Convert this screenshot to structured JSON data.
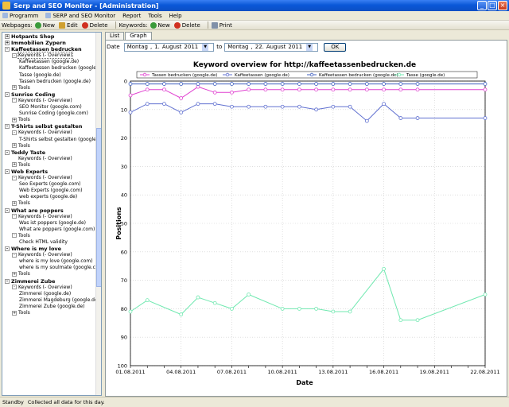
{
  "window": {
    "title": "Serp and SEO Monitor - [Administration]"
  },
  "menu": [
    {
      "label": "Programm"
    },
    {
      "label": "SERP and SEO Monitor"
    },
    {
      "label": "Report"
    },
    {
      "label": "Tools"
    },
    {
      "label": "Help"
    }
  ],
  "toolbar": {
    "webpages_label": "Webpages:",
    "new1": "New",
    "edit": "Edit",
    "delete1": "Delete",
    "keywords_label": "Keywords:",
    "new2": "New",
    "delete2": "Delete",
    "print": "Print"
  },
  "tree": [
    {
      "level": 0,
      "bold": true,
      "pm": "+",
      "text": "Hotpants Shop"
    },
    {
      "level": 0,
      "bold": true,
      "pm": "+",
      "text": "Immobilien Zypern"
    },
    {
      "level": 0,
      "bold": true,
      "pm": "-",
      "text": "Kaffeetassen bedrucken"
    },
    {
      "level": 1,
      "pm": "-",
      "text": "Keywords (- Overview)",
      "sel": true
    },
    {
      "level": 2,
      "text": "Kaffeetassen (google.de)"
    },
    {
      "level": 2,
      "text": "Kaffeetassen bedrucken (google.de)"
    },
    {
      "level": 2,
      "text": "Tasse (google.de)"
    },
    {
      "level": 2,
      "text": "Tassen bedrucken (google.de)"
    },
    {
      "level": 1,
      "pm": "+",
      "text": "Tools"
    },
    {
      "level": 0,
      "bold": true,
      "pm": "-",
      "text": "Sunrise Coding"
    },
    {
      "level": 1,
      "pm": "-",
      "text": "Keywords (- Overview)"
    },
    {
      "level": 2,
      "text": "SEO Monitor (google.com)"
    },
    {
      "level": 2,
      "text": "Sunrise Coding (google.com)"
    },
    {
      "level": 1,
      "pm": "+",
      "text": "Tools"
    },
    {
      "level": 0,
      "bold": true,
      "pm": "-",
      "text": "T-Shirts selbst gestalten"
    },
    {
      "level": 1,
      "pm": "-",
      "text": "Keywords (- Overview)"
    },
    {
      "level": 2,
      "text": "T-Shirts selbst gestalten (google.de)"
    },
    {
      "level": 1,
      "pm": "+",
      "text": "Tools"
    },
    {
      "level": 0,
      "bold": true,
      "pm": "-",
      "text": "Teddy Taste"
    },
    {
      "level": 1,
      "pm": "",
      "text": "Keywords (- Overview)"
    },
    {
      "level": 1,
      "pm": "+",
      "text": "Tools"
    },
    {
      "level": 0,
      "bold": true,
      "pm": "-",
      "text": "Web Experts"
    },
    {
      "level": 1,
      "pm": "-",
      "text": "Keywords (- Overview)"
    },
    {
      "level": 2,
      "text": "Seo Experts (google.com)"
    },
    {
      "level": 2,
      "text": "Web Experts (google.com)"
    },
    {
      "level": 2,
      "text": "web experts (google.de)"
    },
    {
      "level": 1,
      "pm": "+",
      "text": "Tools"
    },
    {
      "level": 0,
      "bold": true,
      "pm": "-",
      "text": "What are poppers"
    },
    {
      "level": 1,
      "pm": "-",
      "text": "Keywords (- Overview)"
    },
    {
      "level": 2,
      "text": "Was ist poppers (google.de)"
    },
    {
      "level": 2,
      "text": "What are poppers (google.com)"
    },
    {
      "level": 1,
      "pm": "-",
      "text": "Tools"
    },
    {
      "level": 2,
      "text": "Check HTML validity"
    },
    {
      "level": 0,
      "bold": true,
      "pm": "-",
      "text": "Where is my love"
    },
    {
      "level": 1,
      "pm": "-",
      "text": "Keywords (- Overview)"
    },
    {
      "level": 2,
      "text": "where is my love (google.com)"
    },
    {
      "level": 2,
      "text": "where is my soulmate (google.com)"
    },
    {
      "level": 1,
      "pm": "+",
      "text": "Tools"
    },
    {
      "level": 0,
      "bold": true,
      "pm": "-",
      "text": "Zimmerei Zube"
    },
    {
      "level": 1,
      "pm": "-",
      "text": "Keywords (- Overview)"
    },
    {
      "level": 2,
      "text": "Zimmerei (google.de)"
    },
    {
      "level": 2,
      "text": "Zimmerei Magdeburg (google.de)"
    },
    {
      "level": 2,
      "text": "Zimmerei Zube (google.de)"
    },
    {
      "level": 1,
      "pm": "+",
      "text": "Tools"
    }
  ],
  "tabs": [
    {
      "label": "List"
    },
    {
      "label": "Graph",
      "active": true
    }
  ],
  "datebar": {
    "date_label": "Date",
    "from": {
      "weekday": "Montag",
      "day": "1.",
      "month": "August",
      "year": "2011"
    },
    "to_label": "to",
    "to": {
      "weekday": "Montag",
      "day": "22.",
      "month": "August",
      "year": "2011"
    },
    "ok_label": "OK"
  },
  "status": {
    "state": "Standby",
    "message": "Collected all data for this day."
  },
  "colors": {
    "pink": "#e040d0",
    "blue": "#6070d0",
    "blue2": "#4060c0",
    "green": "#70e8b0"
  },
  "chart_data": {
    "type": "line",
    "title": "Keyword overview for http://kaffeetassenbedrucken.de",
    "xlabel": "Date",
    "ylabel": "Positions",
    "y_reversed": true,
    "ylim": [
      0,
      100
    ],
    "yticks": [
      0,
      10,
      20,
      30,
      40,
      50,
      60,
      70,
      80,
      90,
      100
    ],
    "xlim": [
      "2011-08-01",
      "2011-08-22"
    ],
    "xtick_labels": [
      "01.08.2011",
      "04.08.2011",
      "07.08.2011",
      "10.08.2011",
      "13.08.2011",
      "16.08.2011",
      "19.08.2011",
      "22.08.2011"
    ],
    "xtick_days": [
      1,
      4,
      7,
      10,
      13,
      16,
      19,
      22
    ],
    "legend_position": "top",
    "grid": true,
    "series": [
      {
        "name": "Tassen bedrucken (google.de)",
        "color": "#e040d0",
        "x": [
          1,
          2,
          3,
          4,
          5,
          6,
          7,
          8,
          9,
          10,
          11,
          12,
          13,
          14,
          15,
          16,
          17,
          18,
          22
        ],
        "y": [
          5,
          3,
          3,
          6,
          2,
          4,
          4,
          3,
          3,
          3,
          3,
          3,
          3,
          3,
          3,
          3,
          3,
          3,
          3
        ]
      },
      {
        "name": "Kaffeetassen (google.de)",
        "color": "#6070d0",
        "x": [
          1,
          2,
          3,
          4,
          5,
          6,
          7,
          8,
          9,
          10,
          11,
          12,
          13,
          14,
          15,
          16,
          17,
          18,
          22
        ],
        "y": [
          11,
          8,
          8,
          11,
          8,
          8,
          9,
          9,
          9,
          9,
          9,
          10,
          9,
          9,
          14,
          8,
          13,
          13,
          13
        ]
      },
      {
        "name": "Kaffeetassen bedrucken (google.de)",
        "color": "#4060c0",
        "x": [
          1,
          2,
          3,
          4,
          5,
          6,
          7,
          8,
          9,
          10,
          11,
          12,
          13,
          14,
          15,
          16,
          17,
          18,
          22
        ],
        "y": [
          1,
          1,
          1,
          1,
          1,
          1,
          1,
          1,
          1,
          1,
          1,
          1,
          1,
          1,
          1,
          1,
          1,
          1,
          1
        ]
      },
      {
        "name": "Tasse (google.de)",
        "color": "#70e8b0",
        "x": [
          1,
          2,
          4,
          5,
          6,
          7,
          8,
          10,
          11,
          12,
          13,
          14,
          16,
          17,
          18,
          22
        ],
        "y": [
          81,
          77,
          82,
          76,
          78,
          80,
          75,
          80,
          80,
          80,
          81,
          81,
          66,
          84,
          84,
          75
        ]
      }
    ]
  }
}
